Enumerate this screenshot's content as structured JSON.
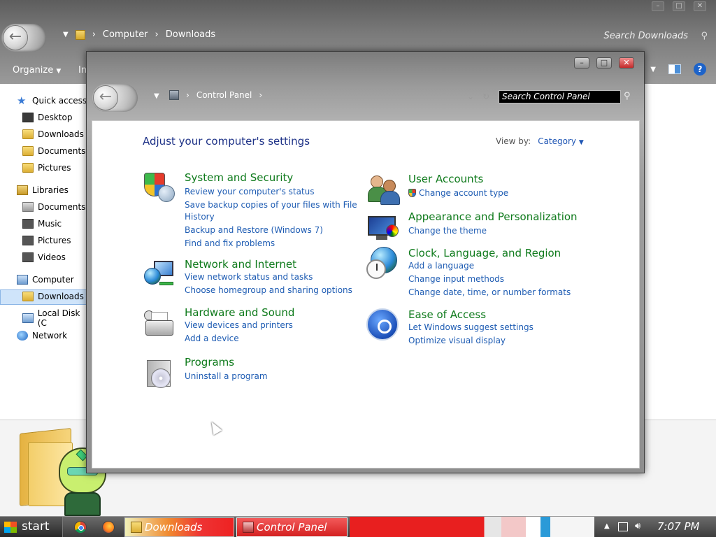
{
  "explorer": {
    "breadcrumb": [
      "Computer",
      "Downloads"
    ],
    "search_placeholder": "Search Downloads",
    "toolbar": {
      "organize": "Organize",
      "include": "In"
    },
    "nav": {
      "quick_access": "Quick access",
      "desktop": "Desktop",
      "downloads_qa": "Downloads",
      "documents_qa": "Documents",
      "pictures_qa": "Pictures",
      "libraries": "Libraries",
      "documents": "Documents",
      "music": "Music",
      "pictures": "Pictures",
      "videos": "Videos",
      "computer": "Computer",
      "downloads": "Downloads",
      "local_disk": "Local Disk (C",
      "network": "Network"
    }
  },
  "control_panel": {
    "breadcrumb": [
      "Control Panel"
    ],
    "search_placeholder": "Search Control Panel",
    "heading": "Adjust your computer's settings",
    "view_by_label": "View by:",
    "view_by_value": "Category",
    "categories": {
      "system_security": {
        "title": "System and Security",
        "links": [
          "Review your computer's status",
          "Save backup copies of your files with File",
          "History",
          "Backup and Restore (Windows 7)",
          "Find and fix problems"
        ]
      },
      "network_internet": {
        "title": "Network and Internet",
        "links": [
          "View network status and tasks",
          "Choose homegroup and sharing options"
        ]
      },
      "hardware_sound": {
        "title": "Hardware and Sound",
        "links": [
          "View devices and printers",
          "Add a device"
        ]
      },
      "programs": {
        "title": "Programs",
        "links": [
          "Uninstall a program"
        ]
      },
      "user_accounts": {
        "title": "User Accounts",
        "links": [
          "Change account type"
        ]
      },
      "appearance": {
        "title": "Appearance and Personalization",
        "links": [
          "Change the theme"
        ]
      },
      "clock_region": {
        "title": "Clock, Language, and Region",
        "links": [
          "Add a language",
          "Change input methods",
          "Change date, time, or number formats"
        ]
      },
      "ease_access": {
        "title": "Ease of Access",
        "links": [
          "Let Windows suggest settings",
          "Optimize visual display"
        ]
      }
    }
  },
  "taskbar": {
    "start_label": "start",
    "tasks": [
      "Downloads",
      "Control Panel"
    ],
    "clock": "7:07 PM"
  }
}
